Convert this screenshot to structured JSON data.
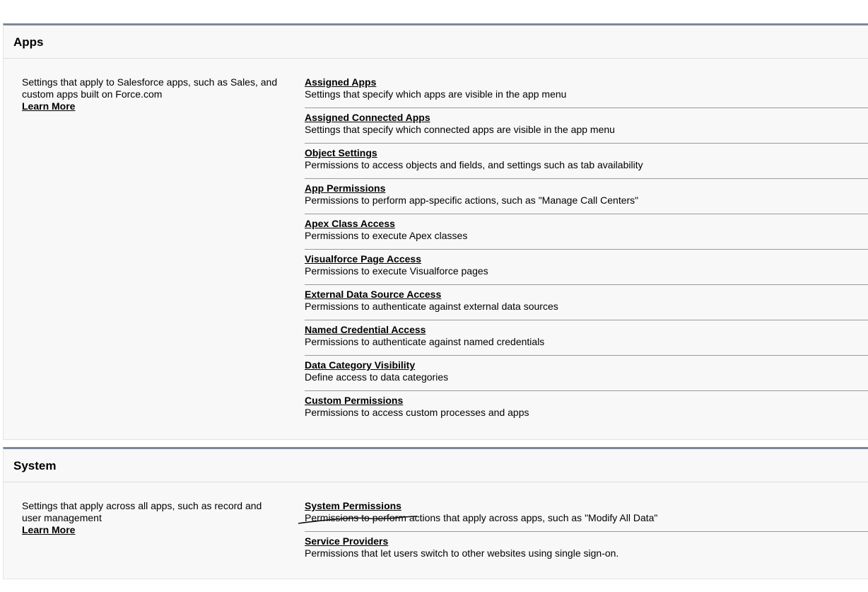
{
  "sections": [
    {
      "title": "Apps",
      "description": "Settings that apply to Salesforce apps, such as Sales, and custom apps built on Force.com",
      "learn_more": "Learn More",
      "items": [
        {
          "title": "Assigned Apps",
          "desc": "Settings that specify which apps are visible in the app menu"
        },
        {
          "title": "Assigned Connected Apps",
          "desc": "Settings that specify which connected apps are visible in the app menu"
        },
        {
          "title": "Object Settings",
          "desc": "Permissions to access objects and fields, and settings such as tab availability"
        },
        {
          "title": "App Permissions",
          "desc": "Permissions to perform app-specific actions, such as \"Manage Call Centers\""
        },
        {
          "title": "Apex Class Access",
          "desc": "Permissions to execute Apex classes"
        },
        {
          "title": "Visualforce Page Access",
          "desc": "Permissions to execute Visualforce pages"
        },
        {
          "title": "External Data Source Access",
          "desc": "Permissions to authenticate against external data sources"
        },
        {
          "title": "Named Credential Access",
          "desc": "Permissions to authenticate against named credentials"
        },
        {
          "title": "Data Category Visibility",
          "desc": "Define access to data categories"
        },
        {
          "title": "Custom Permissions",
          "desc": "Permissions to access custom processes and apps"
        }
      ]
    },
    {
      "title": "System",
      "description": "Settings that apply across all apps, such as record and user management",
      "learn_more": "Learn More",
      "items": [
        {
          "title": "System Permissions",
          "desc": "Permissions to perform actions that apply across apps, such as \"Modify All Data\""
        },
        {
          "title": "Service Providers",
          "desc": "Permissions that let users switch to other websites using single sign-on."
        }
      ]
    }
  ]
}
